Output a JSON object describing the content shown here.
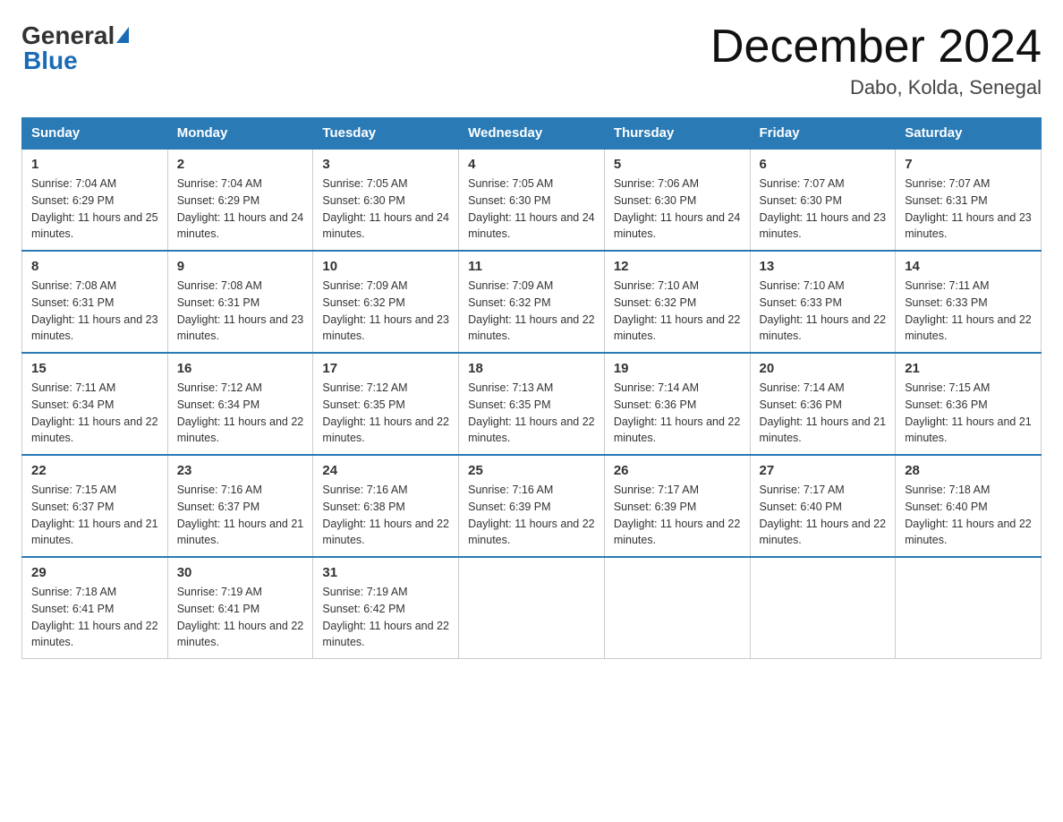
{
  "header": {
    "logo": {
      "general": "General",
      "blue": "Blue"
    },
    "title": "December 2024",
    "location": "Dabo, Kolda, Senegal"
  },
  "days_of_week": [
    "Sunday",
    "Monday",
    "Tuesday",
    "Wednesday",
    "Thursday",
    "Friday",
    "Saturday"
  ],
  "weeks": [
    [
      {
        "day": "1",
        "sunrise": "7:04 AM",
        "sunset": "6:29 PM",
        "daylight": "11 hours and 25 minutes."
      },
      {
        "day": "2",
        "sunrise": "7:04 AM",
        "sunset": "6:29 PM",
        "daylight": "11 hours and 24 minutes."
      },
      {
        "day": "3",
        "sunrise": "7:05 AM",
        "sunset": "6:30 PM",
        "daylight": "11 hours and 24 minutes."
      },
      {
        "day": "4",
        "sunrise": "7:05 AM",
        "sunset": "6:30 PM",
        "daylight": "11 hours and 24 minutes."
      },
      {
        "day": "5",
        "sunrise": "7:06 AM",
        "sunset": "6:30 PM",
        "daylight": "11 hours and 24 minutes."
      },
      {
        "day": "6",
        "sunrise": "7:07 AM",
        "sunset": "6:30 PM",
        "daylight": "11 hours and 23 minutes."
      },
      {
        "day": "7",
        "sunrise": "7:07 AM",
        "sunset": "6:31 PM",
        "daylight": "11 hours and 23 minutes."
      }
    ],
    [
      {
        "day": "8",
        "sunrise": "7:08 AM",
        "sunset": "6:31 PM",
        "daylight": "11 hours and 23 minutes."
      },
      {
        "day": "9",
        "sunrise": "7:08 AM",
        "sunset": "6:31 PM",
        "daylight": "11 hours and 23 minutes."
      },
      {
        "day": "10",
        "sunrise": "7:09 AM",
        "sunset": "6:32 PM",
        "daylight": "11 hours and 23 minutes."
      },
      {
        "day": "11",
        "sunrise": "7:09 AM",
        "sunset": "6:32 PM",
        "daylight": "11 hours and 22 minutes."
      },
      {
        "day": "12",
        "sunrise": "7:10 AM",
        "sunset": "6:32 PM",
        "daylight": "11 hours and 22 minutes."
      },
      {
        "day": "13",
        "sunrise": "7:10 AM",
        "sunset": "6:33 PM",
        "daylight": "11 hours and 22 minutes."
      },
      {
        "day": "14",
        "sunrise": "7:11 AM",
        "sunset": "6:33 PM",
        "daylight": "11 hours and 22 minutes."
      }
    ],
    [
      {
        "day": "15",
        "sunrise": "7:11 AM",
        "sunset": "6:34 PM",
        "daylight": "11 hours and 22 minutes."
      },
      {
        "day": "16",
        "sunrise": "7:12 AM",
        "sunset": "6:34 PM",
        "daylight": "11 hours and 22 minutes."
      },
      {
        "day": "17",
        "sunrise": "7:12 AM",
        "sunset": "6:35 PM",
        "daylight": "11 hours and 22 minutes."
      },
      {
        "day": "18",
        "sunrise": "7:13 AM",
        "sunset": "6:35 PM",
        "daylight": "11 hours and 22 minutes."
      },
      {
        "day": "19",
        "sunrise": "7:14 AM",
        "sunset": "6:36 PM",
        "daylight": "11 hours and 22 minutes."
      },
      {
        "day": "20",
        "sunrise": "7:14 AM",
        "sunset": "6:36 PM",
        "daylight": "11 hours and 21 minutes."
      },
      {
        "day": "21",
        "sunrise": "7:15 AM",
        "sunset": "6:36 PM",
        "daylight": "11 hours and 21 minutes."
      }
    ],
    [
      {
        "day": "22",
        "sunrise": "7:15 AM",
        "sunset": "6:37 PM",
        "daylight": "11 hours and 21 minutes."
      },
      {
        "day": "23",
        "sunrise": "7:16 AM",
        "sunset": "6:37 PM",
        "daylight": "11 hours and 21 minutes."
      },
      {
        "day": "24",
        "sunrise": "7:16 AM",
        "sunset": "6:38 PM",
        "daylight": "11 hours and 22 minutes."
      },
      {
        "day": "25",
        "sunrise": "7:16 AM",
        "sunset": "6:39 PM",
        "daylight": "11 hours and 22 minutes."
      },
      {
        "day": "26",
        "sunrise": "7:17 AM",
        "sunset": "6:39 PM",
        "daylight": "11 hours and 22 minutes."
      },
      {
        "day": "27",
        "sunrise": "7:17 AM",
        "sunset": "6:40 PM",
        "daylight": "11 hours and 22 minutes."
      },
      {
        "day": "28",
        "sunrise": "7:18 AM",
        "sunset": "6:40 PM",
        "daylight": "11 hours and 22 minutes."
      }
    ],
    [
      {
        "day": "29",
        "sunrise": "7:18 AM",
        "sunset": "6:41 PM",
        "daylight": "11 hours and 22 minutes."
      },
      {
        "day": "30",
        "sunrise": "7:19 AM",
        "sunset": "6:41 PM",
        "daylight": "11 hours and 22 minutes."
      },
      {
        "day": "31",
        "sunrise": "7:19 AM",
        "sunset": "6:42 PM",
        "daylight": "11 hours and 22 minutes."
      },
      null,
      null,
      null,
      null
    ]
  ]
}
